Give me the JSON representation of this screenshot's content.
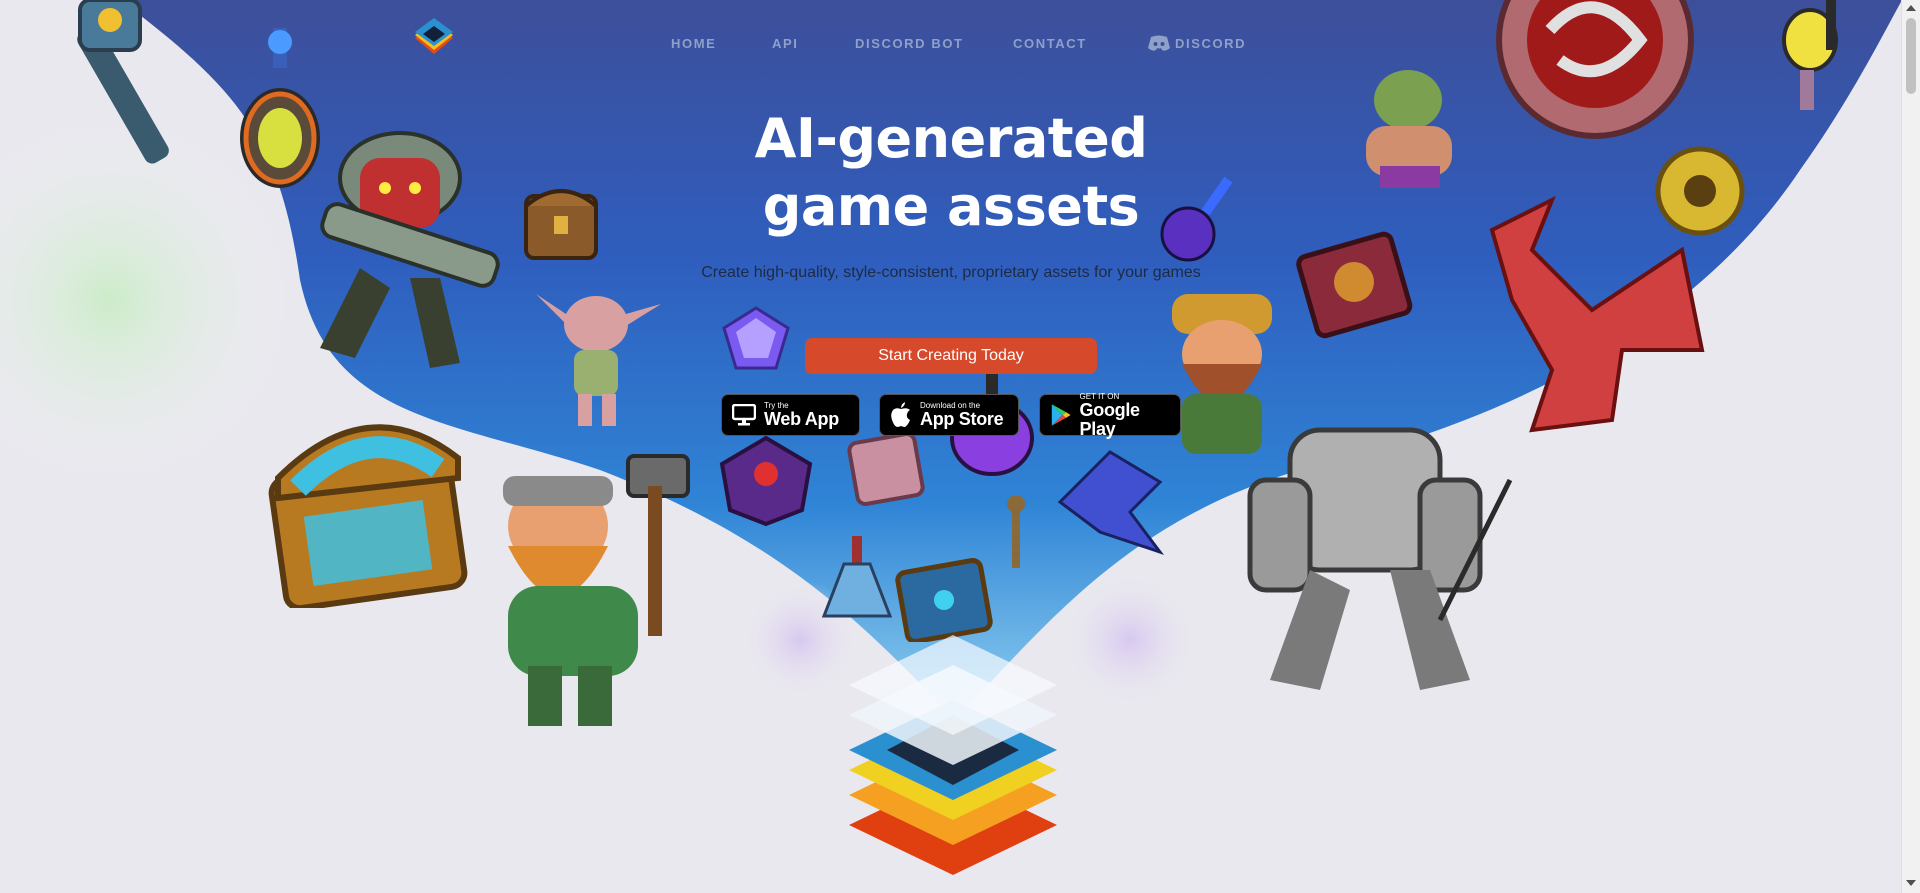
{
  "nav": {
    "items": [
      {
        "label": "HOME"
      },
      {
        "label": "API"
      },
      {
        "label": "DISCORD BOT"
      },
      {
        "label": "CONTACT"
      },
      {
        "label": "DISCORD"
      }
    ]
  },
  "hero": {
    "title_line1": "AI-generated",
    "title_line2": "game assets",
    "subtitle": "Create high-quality, style-consistent, proprietary assets for your games",
    "cta_label": "Start Creating Today"
  },
  "store_buttons": [
    {
      "small": "Try the",
      "big": "Web App",
      "icon": "monitor-icon"
    },
    {
      "small": "Download on the",
      "big": "App Store",
      "icon": "apple-icon"
    },
    {
      "small": "GET IT ON",
      "big": "Google Play",
      "icon": "google-play-icon"
    }
  ],
  "colors": {
    "accent": "#d6492b",
    "hero_blue": "#2d64c6",
    "nav_text": "#8fa0c9"
  },
  "assets": [
    "mace-icon",
    "potion-icon",
    "robot-warrior-icon",
    "treasure-chest-icon",
    "goblin-icon",
    "crystal-icon",
    "blue-chest-icon",
    "dwarf-hammer-icon",
    "cube-gem-icon",
    "spellbook-icon",
    "purple-potion-icon",
    "dragon-icon",
    "armored-knight-icon",
    "dwarf-icon",
    "orc-icon",
    "red-shield-icon",
    "gold-coin-icon",
    "spellbook-red-icon",
    "red-dragon-icon",
    "guitar-icon"
  ]
}
